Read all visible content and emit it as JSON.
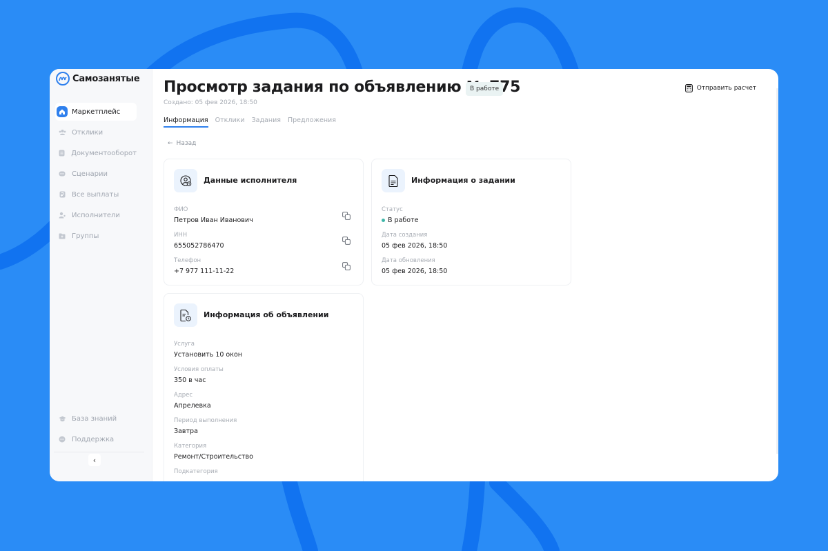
{
  "app": {
    "logo_text": "Самозанятые"
  },
  "sidebar": {
    "items": [
      {
        "id": "marketplace",
        "label": "Маркетплейс",
        "icon": "home-icon",
        "active": true
      },
      {
        "id": "responses",
        "label": "Отклики",
        "icon": "users-icon",
        "active": false
      },
      {
        "id": "documents",
        "label": "Документооборот",
        "icon": "document-icon",
        "active": false
      },
      {
        "id": "scenarios",
        "label": "Сценарии",
        "icon": "chat-icon",
        "active": false
      },
      {
        "id": "payments",
        "label": "Все выплаты",
        "icon": "wallet-icon",
        "active": false
      },
      {
        "id": "executors",
        "label": "Исполнители",
        "icon": "user-icon",
        "active": false
      },
      {
        "id": "groups",
        "label": "Группы",
        "icon": "folder-icon",
        "active": false
      }
    ],
    "bottom_items": [
      {
        "id": "knowledge",
        "label": "База знаний",
        "icon": "graduation-icon"
      },
      {
        "id": "support",
        "label": "Поддержка",
        "icon": "support-icon"
      }
    ]
  },
  "header": {
    "title": "Просмотр задания по объявлению № 775",
    "status_badge": "В работе",
    "created": "Создано: 05 фев 2026, 18:50",
    "send_button": "Отправить расчет"
  },
  "tabs": [
    {
      "label": "Информация",
      "active": true
    },
    {
      "label": "Отклики",
      "active": false
    },
    {
      "label": "Задания",
      "active": false
    },
    {
      "label": "Предложения",
      "active": false
    }
  ],
  "back_label": "Назад",
  "executor_card": {
    "title": "Данные исполнителя",
    "fields": [
      {
        "label": "ФИО",
        "value": "Петров Иван Иванович"
      },
      {
        "label": "ИНН",
        "value": "655052786470"
      },
      {
        "label": "Телефон",
        "value": "+7 977 111-11-22"
      }
    ]
  },
  "task_card": {
    "title": "Информация о задании",
    "status_label": "Статус",
    "status_value": "В работе",
    "status_color": "#3fb6a8",
    "fields": [
      {
        "label": "Дата создания",
        "value": "05 фев 2026, 18:50"
      },
      {
        "label": "Дата обновления",
        "value": "05 фев 2026, 18:50"
      }
    ]
  },
  "ad_card": {
    "title": "Информация об объявлении",
    "fields": [
      {
        "label": "Услуга",
        "value": "Установить 10 окон"
      },
      {
        "label": "Условия оплаты",
        "value": "350 в час"
      },
      {
        "label": "Адрес",
        "value": "Апрелевка"
      },
      {
        "label": "Период выполнения",
        "value": "Завтра"
      },
      {
        "label": "Категория",
        "value": "Ремонт/Строительство"
      },
      {
        "label": "Подкатегория",
        "value": ""
      }
    ]
  },
  "colors": {
    "background": "#2a8cf6",
    "accent": "#2f80ed"
  }
}
